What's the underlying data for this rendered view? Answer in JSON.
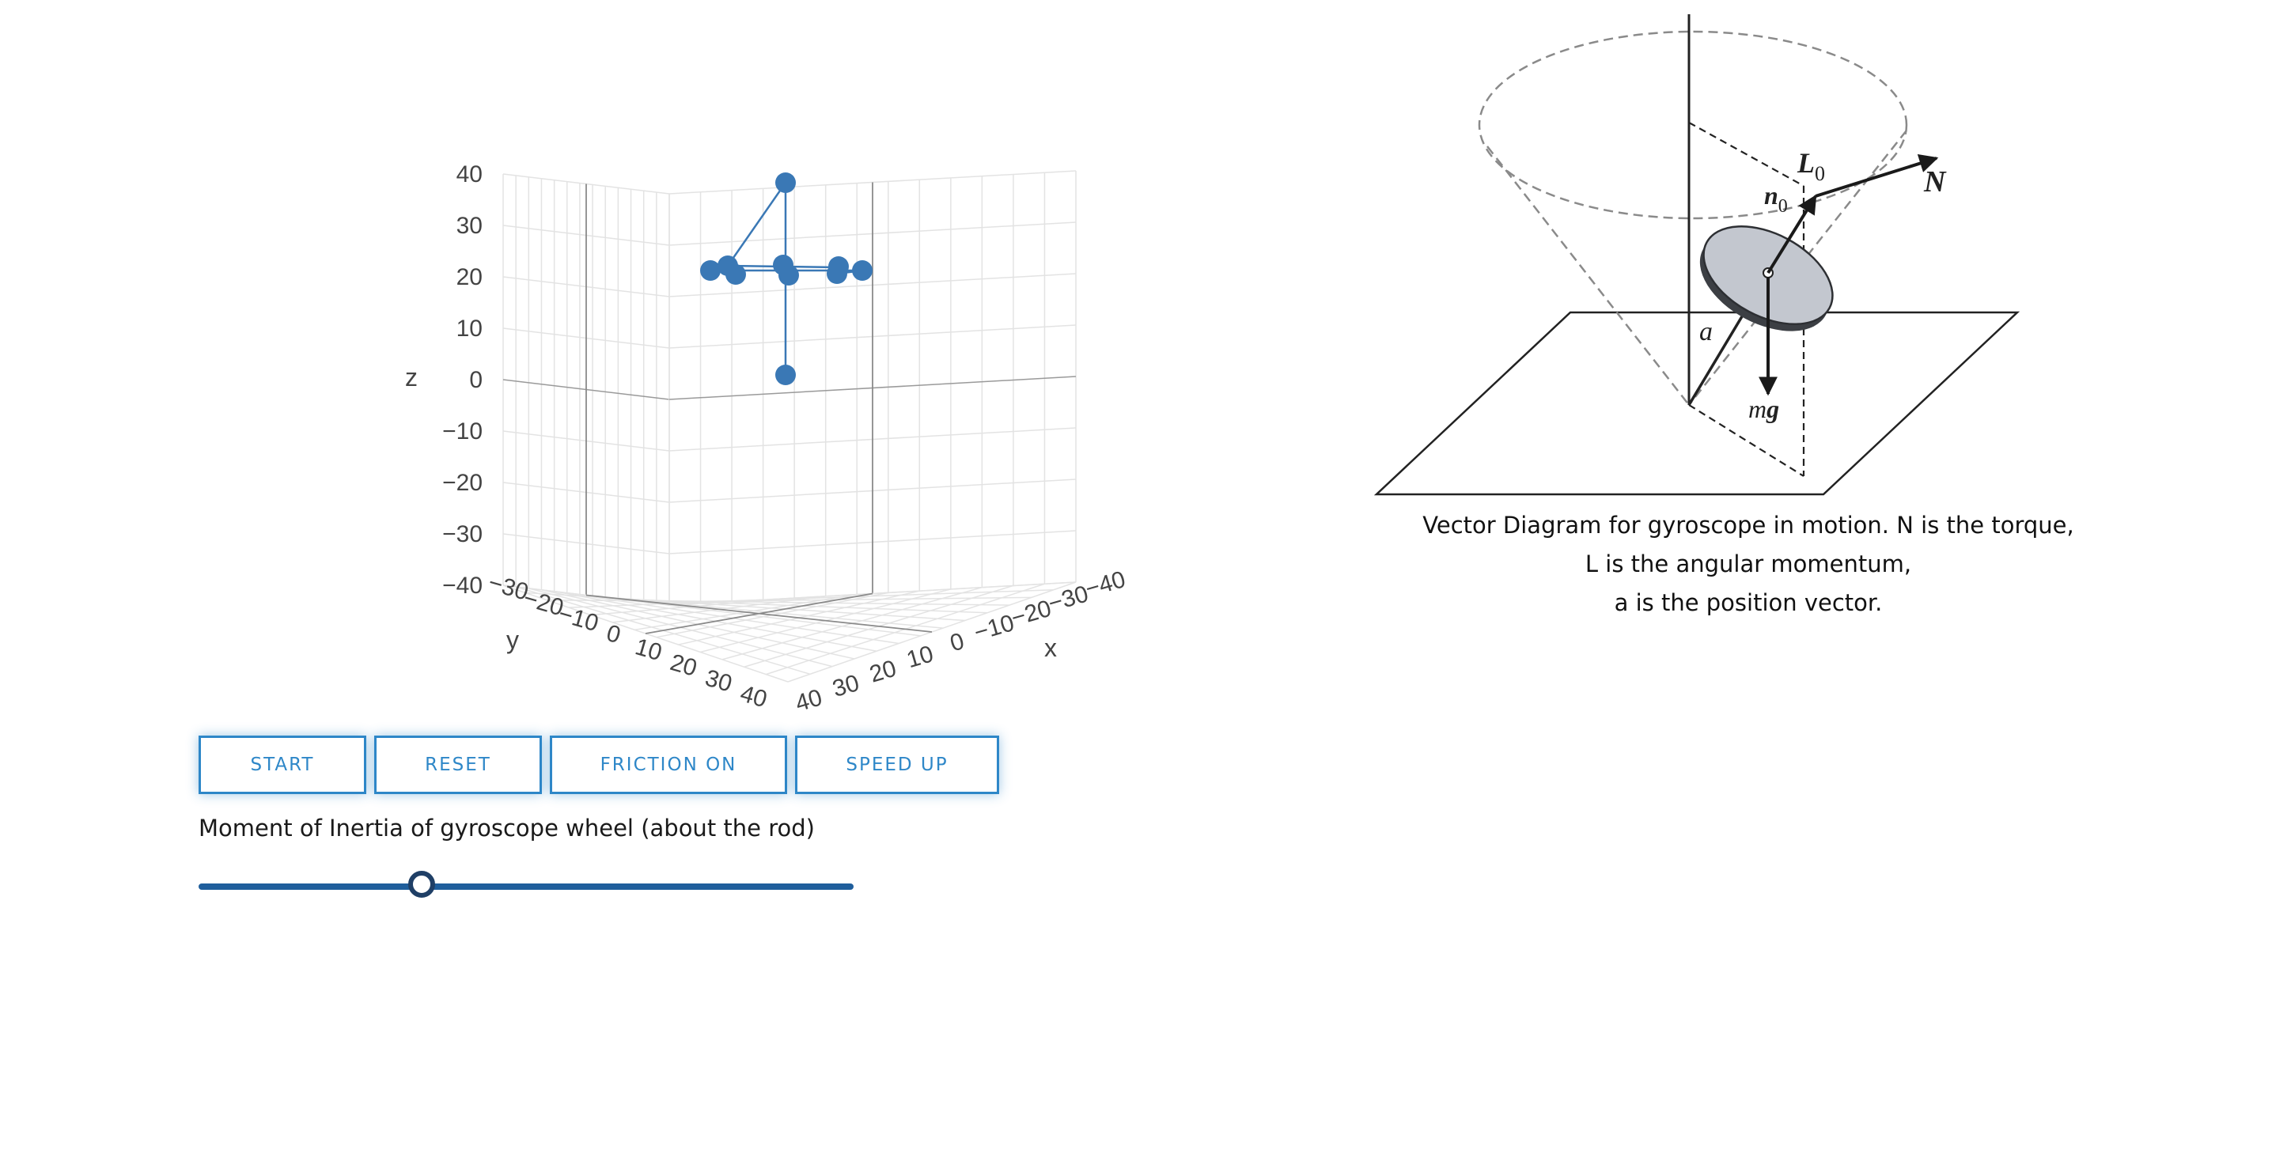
{
  "plot3d": {
    "axis_titles": {
      "x": "x",
      "y": "y",
      "z": "z"
    },
    "z_ticks": [
      "40",
      "30",
      "20",
      "10",
      "0",
      "−10",
      "−20",
      "−30",
      "−40"
    ],
    "y_ticks": [
      "−30",
      "−20",
      "−10",
      "0",
      "10",
      "20",
      "30",
      "40"
    ],
    "x_ticks": [
      "40",
      "30",
      "20",
      "10",
      "0",
      "−10",
      "−20",
      "−30",
      "−40"
    ],
    "marker_color": "#3a78b5"
  },
  "buttons": [
    {
      "label": "START"
    },
    {
      "label": "RESET"
    },
    {
      "label": "FRICTION ON"
    },
    {
      "label": "SPEED UP"
    }
  ],
  "slider": {
    "label": "Moment of Inertia of gyroscope wheel (about the rod)",
    "value_fraction": 0.34
  },
  "diagram": {
    "labels": {
      "L": "L",
      "L_sub": "0",
      "n": "n",
      "n_sub": "0",
      "N": "N",
      "a": "a",
      "mg_m": "m",
      "mg_g": "g"
    }
  },
  "caption": {
    "line1": "Vector Diagram for gyroscope in motion. N is the torque,",
    "line2": "L is the angular momentum,",
    "line3": "a is the position vector."
  }
}
